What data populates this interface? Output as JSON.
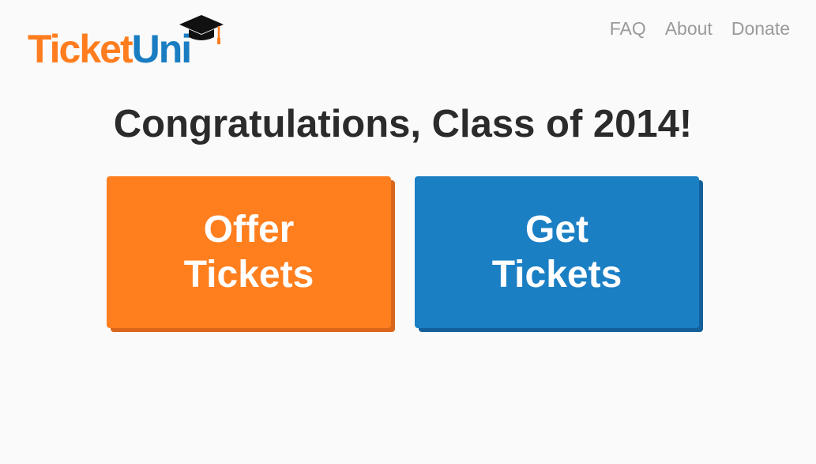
{
  "header": {
    "logo": {
      "part1": "Ticket",
      "part2": "Uni",
      "icon": "graduation-cap-icon"
    },
    "nav": [
      {
        "label": "FAQ"
      },
      {
        "label": "About"
      },
      {
        "label": "Donate"
      }
    ]
  },
  "main": {
    "headline": "Congratulations, Class of 2014!",
    "buttons": {
      "offer": {
        "line1": "Offer",
        "line2": "Tickets",
        "color": "#ff7f1f"
      },
      "get": {
        "line1": "Get",
        "line2": "Tickets",
        "color": "#1b7fc4"
      }
    }
  },
  "colors": {
    "background": "#fafafa",
    "brand_orange": "#ff7d1f",
    "brand_blue": "#1a7dc2",
    "nav_text": "#9a9a9a",
    "headline_text": "#2b2b2b"
  }
}
